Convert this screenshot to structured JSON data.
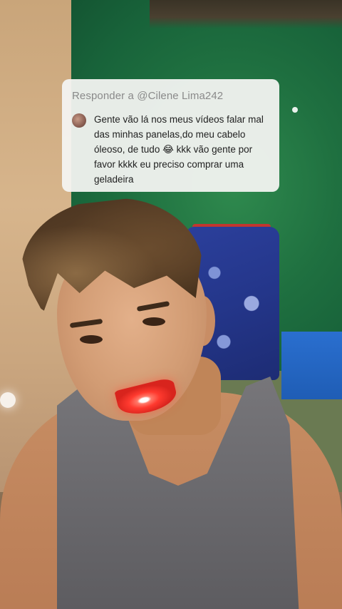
{
  "reply_card": {
    "header": "Responder a @Cilene Lima242",
    "comment_lines": [
      "Gente vão lá nos meus vídeos falar mal",
      "das minhas panelas,do meu cabelo",
      "óleoso, de tudo 😂 kkk vão gente por",
      "favor kkkk eu preciso comprar uma",
      "geladeira"
    ]
  },
  "colors": {
    "card_background": "#f4f4f2",
    "header_text": "#8a8a8a",
    "comment_text": "#222222"
  }
}
